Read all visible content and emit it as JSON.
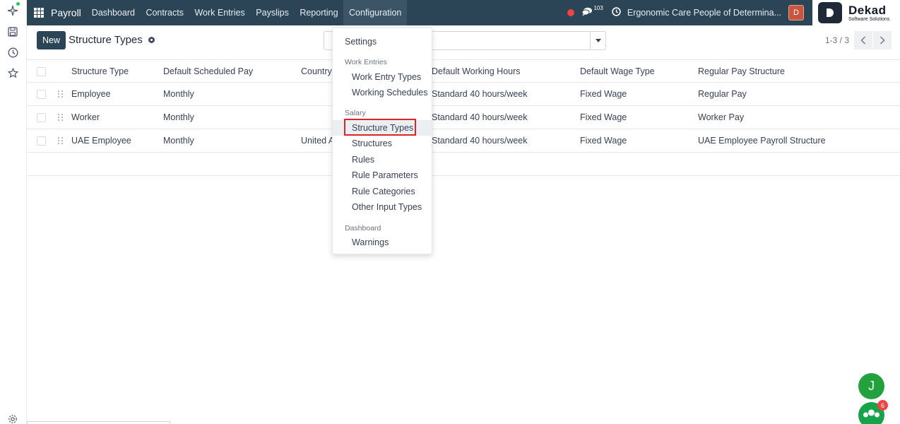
{
  "navbar": {
    "app_name": "Payroll",
    "menus": [
      "Dashboard",
      "Contracts",
      "Work Entries",
      "Payslips",
      "Reporting",
      "Configuration"
    ],
    "active_menu": "Configuration",
    "message_count": "103",
    "company": "Ergonomic Care People of Determina...",
    "user_initial": "D"
  },
  "logo": {
    "name": "Dekad",
    "tagline": "Software Solutions"
  },
  "control": {
    "new_label": "New",
    "title": "Structure Types",
    "pager": "1-3 / 3"
  },
  "table": {
    "columns": [
      "Structure Type",
      "Default Scheduled Pay",
      "Country",
      "Default Working Hours",
      "Default Wage Type",
      "Regular Pay Structure"
    ],
    "rows": [
      {
        "name": "Employee",
        "pay": "Monthly",
        "country": "",
        "hours": "Standard 40 hours/week",
        "wage": "Fixed Wage",
        "structure": "Regular Pay"
      },
      {
        "name": "Worker",
        "pay": "Monthly",
        "country": "",
        "hours": "Standard 40 hours/week",
        "wage": "Fixed Wage",
        "structure": "Worker Pay"
      },
      {
        "name": "UAE Employee",
        "pay": "Monthly",
        "country": "United A",
        "hours": "Standard 40 hours/week",
        "wage": "Fixed Wage",
        "structure": "UAE Employee Payroll Structure"
      }
    ]
  },
  "dropdown": {
    "settings": "Settings",
    "work_entries_header": "Work Entries",
    "work_entries": [
      "Work Entry Types",
      "Working Schedules"
    ],
    "salary_header": "Salary",
    "salary": [
      "Structure Types",
      "Structures",
      "Rules",
      "Rule Parameters",
      "Rule Categories",
      "Other Input Types"
    ],
    "dashboard_header": "Dashboard",
    "dashboard": [
      "Warnings"
    ],
    "selected": "Structure Types"
  },
  "chat": {
    "user_initial": "J",
    "notification_count": "6"
  },
  "colors": {
    "navbar": "#2b4556",
    "accent_red": "#dc2626",
    "chat_green": "#22a13d"
  }
}
